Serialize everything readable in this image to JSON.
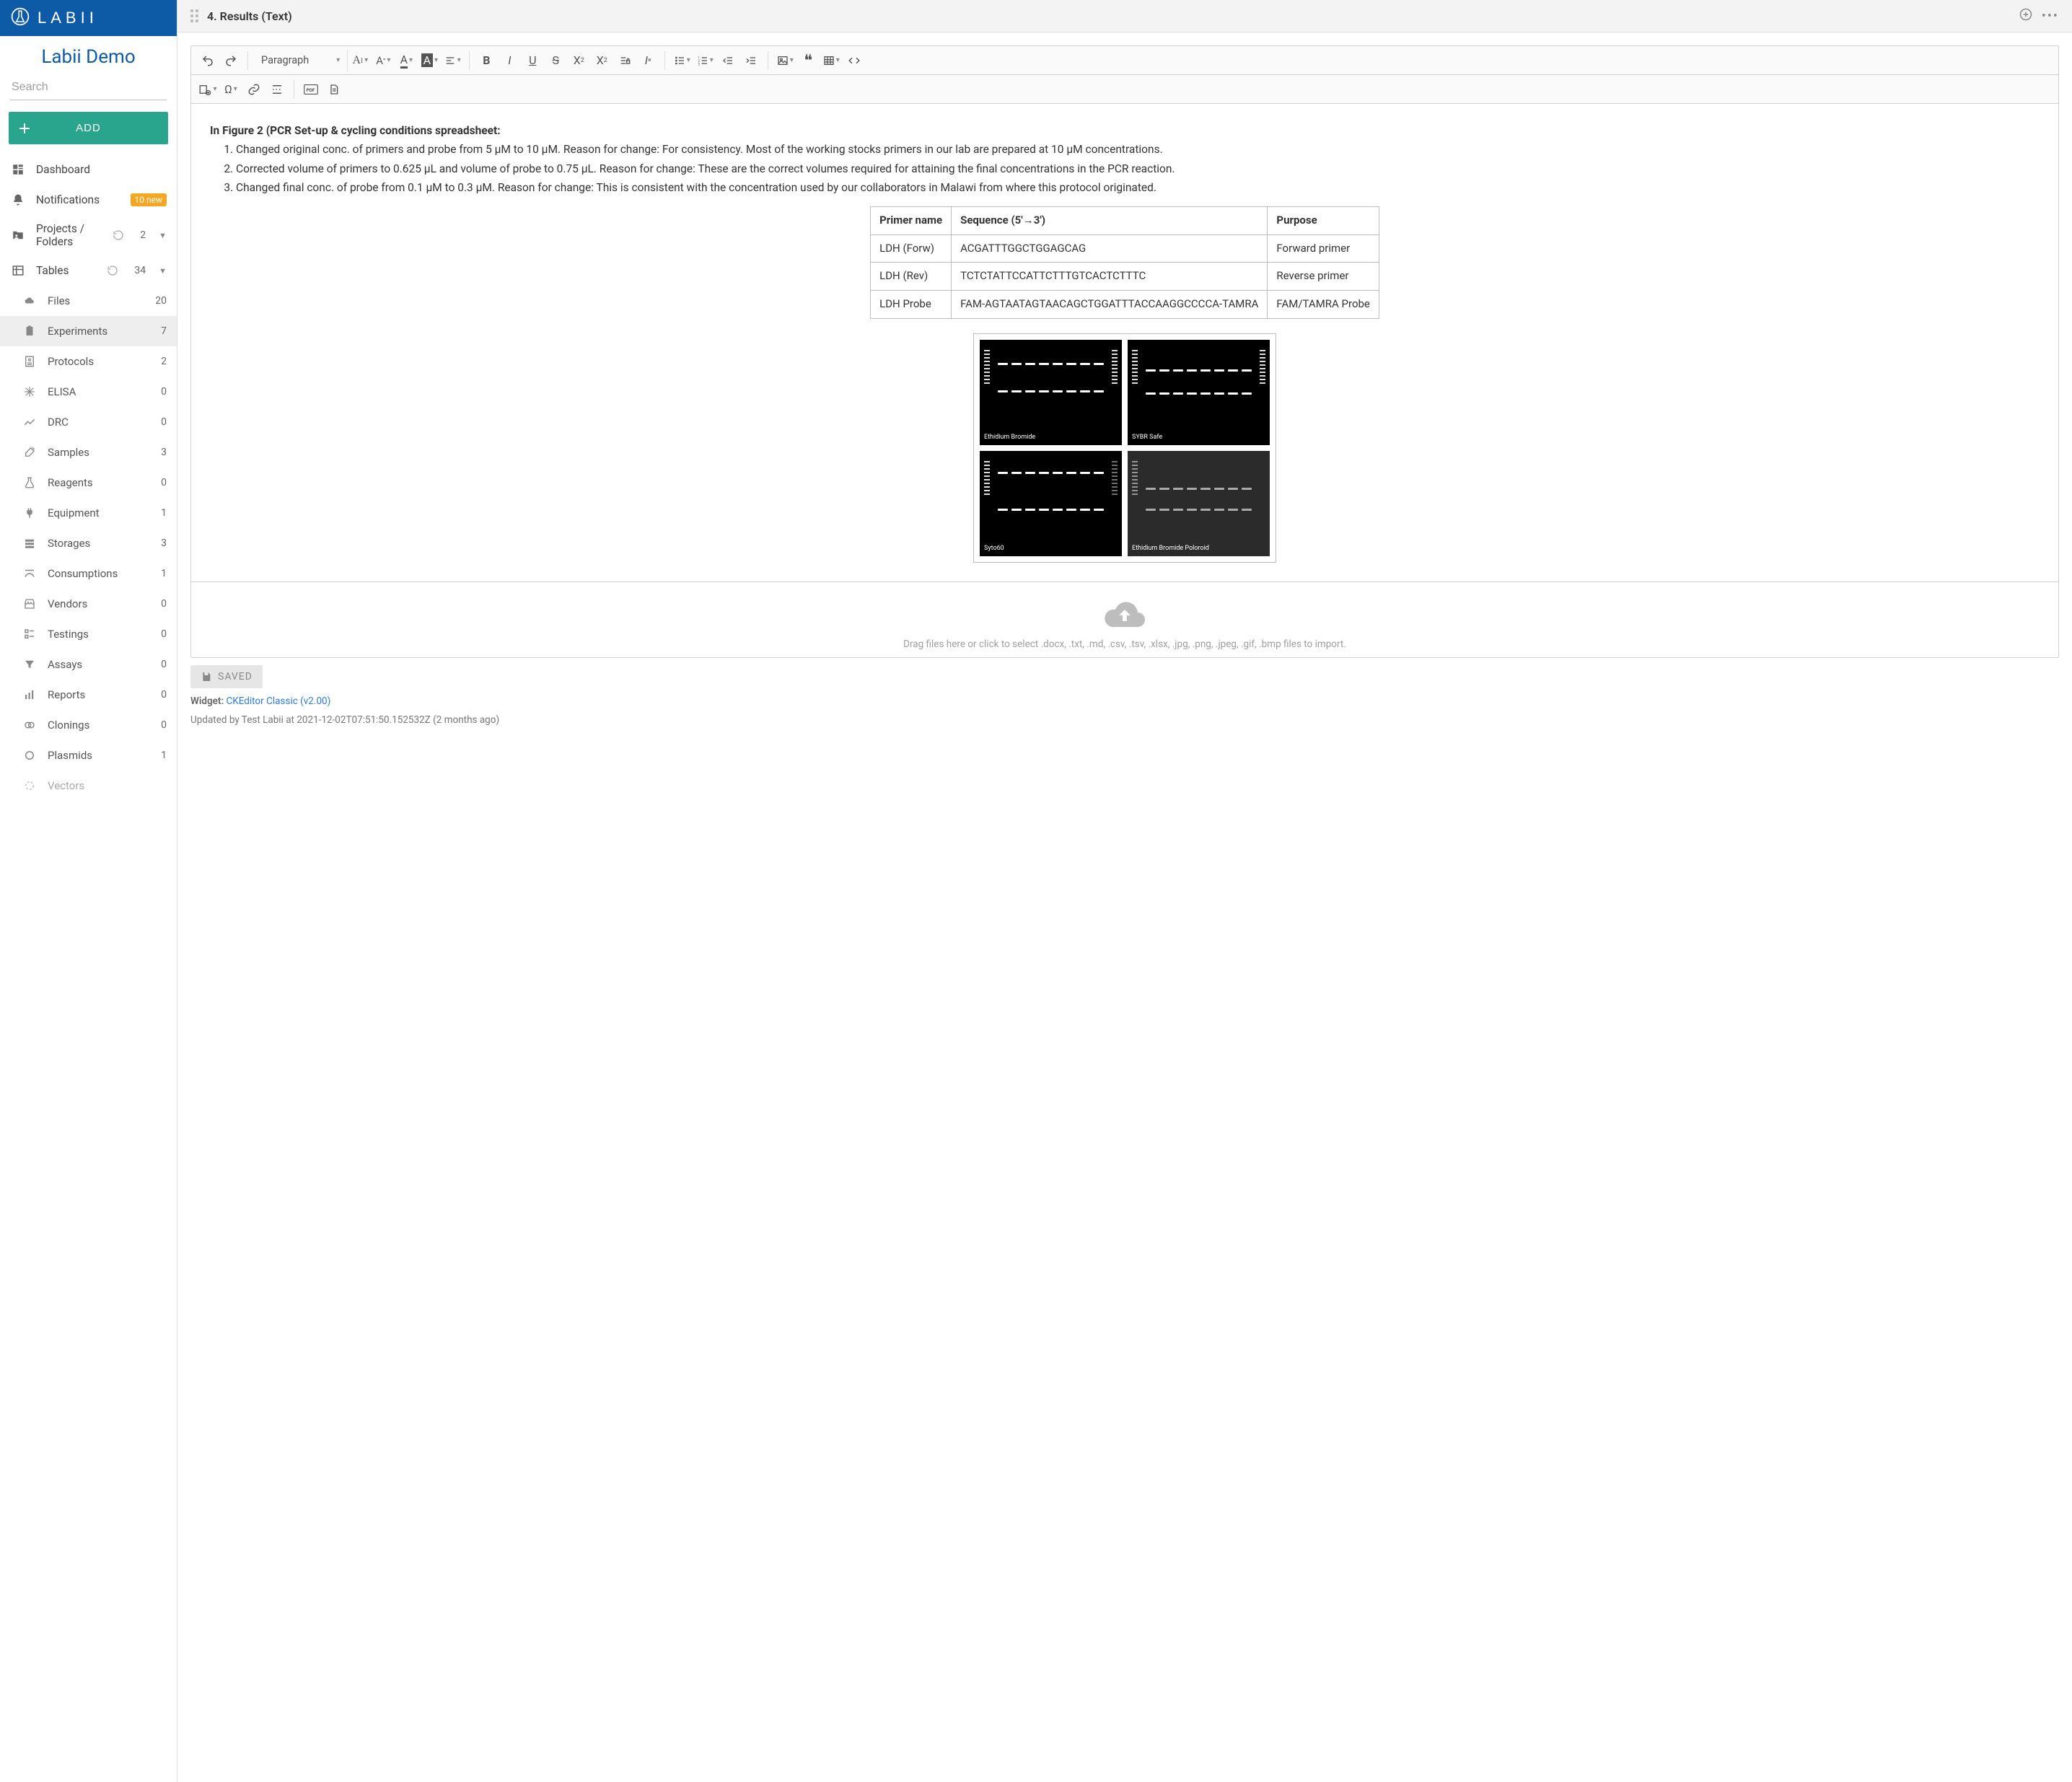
{
  "brand": {
    "name": "LaBII",
    "workspace": "Labii Demo"
  },
  "search": {
    "placeholder": "Search"
  },
  "add_button": "ADD",
  "sidebar": {
    "top": [
      {
        "label": "Dashboard",
        "count": ""
      },
      {
        "label": "Notifications",
        "badge": "10 new"
      },
      {
        "label": "Projects / Folders",
        "count": "2",
        "has_chevron": true,
        "has_refresh": true
      },
      {
        "label": "Tables",
        "count": "34",
        "has_chevron": true,
        "has_refresh": true
      }
    ],
    "tables": [
      {
        "label": "Files",
        "count": "20"
      },
      {
        "label": "Experiments",
        "count": "7",
        "active": true
      },
      {
        "label": "Protocols",
        "count": "2"
      },
      {
        "label": "ELISA",
        "count": "0"
      },
      {
        "label": "DRC",
        "count": "0"
      },
      {
        "label": "Samples",
        "count": "3"
      },
      {
        "label": "Reagents",
        "count": "0"
      },
      {
        "label": "Equipment",
        "count": "1"
      },
      {
        "label": "Storages",
        "count": "3"
      },
      {
        "label": "Consumptions",
        "count": "1"
      },
      {
        "label": "Vendors",
        "count": "0"
      },
      {
        "label": "Testings",
        "count": "0"
      },
      {
        "label": "Assays",
        "count": "0"
      },
      {
        "label": "Reports",
        "count": "0"
      },
      {
        "label": "Clonings",
        "count": "0"
      },
      {
        "label": "Plasmids",
        "count": "1"
      },
      {
        "label": "Vectors",
        "count": ""
      }
    ]
  },
  "section": {
    "title": "4. Results (Text)"
  },
  "toolbar": {
    "paragraph_label": "Paragraph"
  },
  "content": {
    "figure_heading": "In Figure 2 (PCR Set-up & cycling conditions spreadsheet:",
    "ol": [
      "Changed original conc. of primers and probe from 5 µM to 10 µM. Reason for change: For consistency. Most of the working stocks primers in our lab are prepared at 10 µM concentrations.",
      "Corrected volume of primers to 0.625 µL and volume of probe to 0.75 µL. Reason for change: These are the correct volumes required for attaining the final concentrations in the PCR reaction.",
      "Changed final conc. of probe from 0.1 µM to 0.3 µM. Reason for change: This is consistent with the concentration used by our collaborators in Malawi from where this protocol originated."
    ],
    "table": {
      "head": [
        "Primer name",
        "Sequence (5'→3')",
        "Purpose"
      ],
      "rows": [
        [
          "LDH (Forw)",
          "ACGATTTGGCTGGAGCAG",
          "Forward primer"
        ],
        [
          "LDH (Rev)",
          "TCTCTATTCCATTCTTTGTCACTCTTTC",
          "Reverse primer"
        ],
        [
          "LDH Probe",
          "FAM-AGTAATAGTAACAGCTGGATTTACCAAGGCCCCA-TAMRA",
          "FAM/TAMRA Probe"
        ]
      ]
    },
    "gel_labels": [
      "Ethidium Bromide",
      "SYBR Safe",
      "Syto60",
      "Ethidium Bromide Poloroid"
    ]
  },
  "upload": {
    "hint": "Drag files here or click to select .docx, .txt, .md, .csv, .tsv, .xlsx, .jpg, .png, .jpeg, .gif, .bmp files to import."
  },
  "saved_button": "SAVED",
  "meta": {
    "widget_label": "Widget:",
    "widget_link": "CKEditor Classic (v2.00)",
    "updated": "Updated by Test Labii at 2021-12-02T07:51:50.152532Z (2 months ago)"
  }
}
